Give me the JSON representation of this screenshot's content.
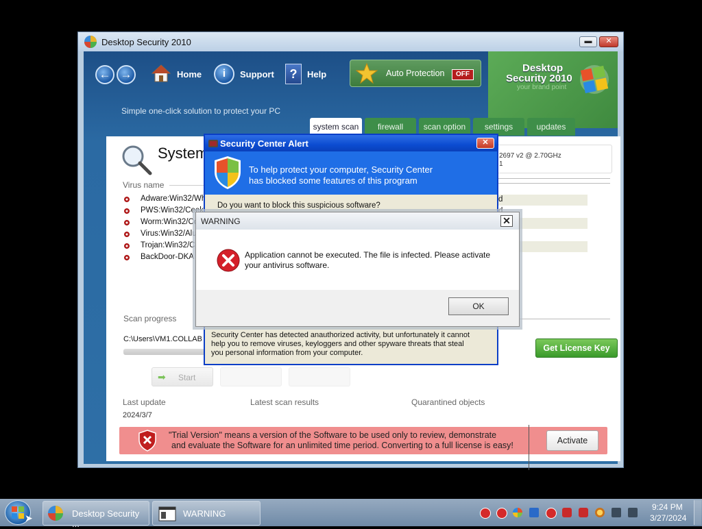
{
  "window": {
    "title": "Desktop Security 2010",
    "minimize_icon": "minimize-icon",
    "close_icon": "close-icon"
  },
  "header": {
    "nav": [
      {
        "label": "Home",
        "icon": "home-icon"
      },
      {
        "label": "Support",
        "icon": "info-icon"
      },
      {
        "label": "Help",
        "icon": "help-icon"
      }
    ],
    "auto_protection_label": "Auto Protection",
    "auto_protection_status": "OFF",
    "brand_line1": "Desktop",
    "brand_line2": "Security 2010",
    "brand_tagline": "your brand point",
    "slogan": "Simple one-click solution to protect your PC",
    "tabs": [
      "system scan",
      "firewall",
      "scan option",
      "settings",
      "updates"
    ],
    "active_tab": "system scan"
  },
  "content": {
    "title": "System scan",
    "cpu_info": "2697 v2 @ 2.70GHz",
    "cpu_info2": "1",
    "virus_header": "Virus name",
    "viruses": [
      {
        "name": "Adware:Win32/Wh",
        "status": "d"
      },
      {
        "name": "PWS:Win32/Ceek",
        "status": "d"
      },
      {
        "name": "Worm:Win32/Confi",
        "status": "d"
      },
      {
        "name": "Virus:Win32/Alur",
        "status": "d"
      },
      {
        "name": "Trojan:Win32/Cr",
        "status": ""
      },
      {
        "name": "BackDoor-DKA I",
        "status": ""
      }
    ],
    "scan_progress_label": "Scan progress",
    "scan_path": "C:\\Users\\VM1.COLLAB",
    "license_button": "Get License Key",
    "start_button": "Start",
    "last_update_label": "Last update",
    "last_update_value": "2024/3/7",
    "latest_results_label": "Latest scan results",
    "quarantined_label": "Quarantined objects",
    "trial_text_line1": "\"Trial Version\" means a version of the Software to be used only to review, demonstrate",
    "trial_text_line2": "and evaluate the Software for an unlimited time period. Converting to a full license is easy!",
    "activate_button": "Activate"
  },
  "security_alert": {
    "title": "Security Center Alert",
    "headline1": "To help protect your computer, Security Center",
    "headline2": "has blocked some features of this program",
    "question": "Do you want to block this suspicious software?",
    "body1": "Security Center has detected anauthorized activity, but unfortunately it cannot",
    "body2": "help you to remove viruses, keyloggers and other spyware threats that steal",
    "body3": "you personal information from your computer."
  },
  "warning_dialog": {
    "title": "WARNING",
    "message1": "Application cannot be executed. The file is infected. Please activate",
    "message2": "your antivirus software.",
    "ok_label": "OK"
  },
  "taskbar": {
    "items": [
      {
        "label": "Desktop Security ..."
      },
      {
        "label": "WARNING"
      }
    ],
    "time": "9:24 PM",
    "date": "3/27/2024"
  },
  "colors": {
    "alert_blue": "#1f6ee6",
    "trial_banner": "#f08e8e",
    "off_badge": "#b51d1d",
    "license_green": "#3a9a2b"
  }
}
